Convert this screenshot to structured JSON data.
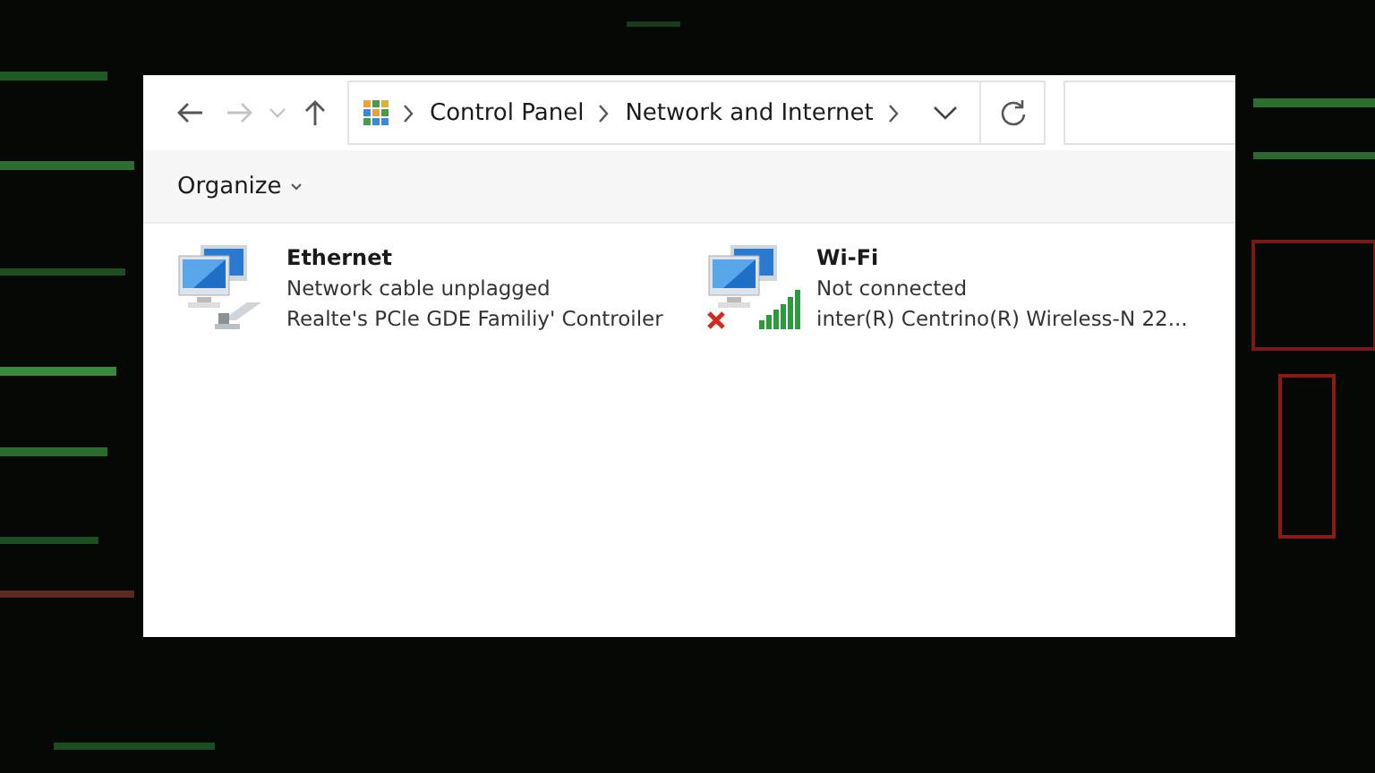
{
  "toolbar": {
    "nav_buttons": [
      {
        "kind": "back",
        "disabled": false
      },
      {
        "kind": "forward",
        "disabled": true
      },
      {
        "kind": "recent",
        "disabled": true
      },
      {
        "kind": "up",
        "disabled": false
      }
    ],
    "breadcrumbs": [
      "Control Panel",
      "Network and Internet"
    ]
  },
  "command_bar": {
    "organize": "Organize"
  },
  "adapters": [
    {
      "kind": "ethernet",
      "name": "Ethernet",
      "status": "Network cable unplagged",
      "device": "Realte's PCle GDE Familiy' Controiler"
    },
    {
      "kind": "wifi",
      "name": "Wi-Fi",
      "status": "Not connected",
      "device": "inter(R) Centrino(R) Wireless-N 22..."
    }
  ]
}
